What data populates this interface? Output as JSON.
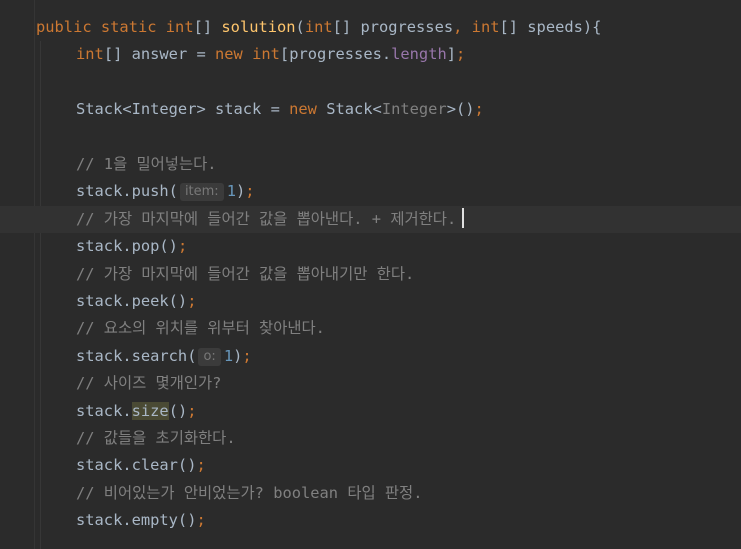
{
  "editor": {
    "lines": [
      {
        "tokens": [
          {
            "t": "public",
            "c": "kw"
          },
          {
            "t": " "
          },
          {
            "t": "static",
            "c": "kw"
          },
          {
            "t": " "
          },
          {
            "t": "int",
            "c": "kw"
          },
          {
            "t": "[] "
          },
          {
            "t": "solution",
            "c": "fn"
          },
          {
            "t": "("
          },
          {
            "t": "int",
            "c": "kw"
          },
          {
            "t": "[] progresses"
          },
          {
            "t": ",",
            "c": "kw"
          },
          {
            "t": " "
          },
          {
            "t": "int",
            "c": "kw"
          },
          {
            "t": "[] speeds){"
          }
        ]
      },
      {
        "tokens": [
          {
            "t": "int",
            "c": "kw"
          },
          {
            "t": "[] answer = "
          },
          {
            "t": "new",
            "c": "kw"
          },
          {
            "t": " "
          },
          {
            "t": "int",
            "c": "kw"
          },
          {
            "t": "[progresses."
          },
          {
            "t": "length",
            "c": "field"
          },
          {
            "t": "]"
          },
          {
            "t": ";",
            "c": "kw"
          }
        ]
      },
      {
        "tokens": []
      },
      {
        "tokens": [
          {
            "t": "Stack<Integer> stack = "
          },
          {
            "t": "new",
            "c": "kw"
          },
          {
            "t": " Stack<"
          },
          {
            "t": "Integer",
            "c": "generic"
          },
          {
            "t": ">()"
          },
          {
            "t": ";",
            "c": "kw"
          }
        ]
      },
      {
        "tokens": []
      },
      {
        "tokens": [
          {
            "t": "// 1을 밀어넣는다.",
            "c": "cmt"
          }
        ]
      },
      {
        "tokens": [
          {
            "t": "stack.push("
          },
          {
            "t": "item:",
            "c": "hint"
          },
          {
            "t": "1",
            "c": "num"
          },
          {
            "t": ")"
          },
          {
            "t": ";",
            "c": "kw"
          }
        ]
      },
      {
        "current": true,
        "tokens": [
          {
            "t": "// 가장 마지막에 들어간 값을 뽑아낸다. + 제거한다.",
            "c": "cmt"
          },
          {
            "t": "",
            "c": "caret"
          }
        ]
      },
      {
        "tokens": [
          {
            "t": "stack.pop()"
          },
          {
            "t": ";",
            "c": "kw"
          }
        ]
      },
      {
        "tokens": [
          {
            "t": "// 가장 마지막에 들어간 값을 뽑아내기만 한다.",
            "c": "cmt"
          }
        ]
      },
      {
        "tokens": [
          {
            "t": "stack.peek()"
          },
          {
            "t": ";",
            "c": "kw"
          }
        ]
      },
      {
        "tokens": [
          {
            "t": "// 요소의 위치를 위부터 찾아낸다.",
            "c": "cmt"
          }
        ]
      },
      {
        "tokens": [
          {
            "t": "stack.search("
          },
          {
            "t": "o:",
            "c": "hint"
          },
          {
            "t": "1",
            "c": "num"
          },
          {
            "t": ")"
          },
          {
            "t": ";",
            "c": "kw"
          }
        ]
      },
      {
        "tokens": [
          {
            "t": "// 사이즈 몇개인가?",
            "c": "cmt"
          }
        ]
      },
      {
        "tokens": [
          {
            "t": "stack."
          },
          {
            "t": "size",
            "c": "hl-size"
          },
          {
            "t": "()"
          },
          {
            "t": ";",
            "c": "kw"
          }
        ]
      },
      {
        "tokens": [
          {
            "t": "// 값들을 초기화한다.",
            "c": "cmt"
          }
        ]
      },
      {
        "tokens": [
          {
            "t": "stack.clear()"
          },
          {
            "t": ";",
            "c": "kw"
          }
        ]
      },
      {
        "tokens": [
          {
            "t": "// 비어있는가 안비었는가? boolean 타입 판정.",
            "c": "cmt"
          }
        ]
      },
      {
        "tokens": [
          {
            "t": "stack.empty()"
          },
          {
            "t": ";",
            "c": "kw"
          }
        ]
      }
    ]
  },
  "icons": {
    "intention_bulb": "lightbulb-icon"
  },
  "colors": {
    "background": "#2b2b2b",
    "keyword": "#cc7832",
    "function": "#ffc66d",
    "field": "#9876aa",
    "number": "#6897bb",
    "comment": "#808080",
    "text": "#a9b7c6",
    "bulb": "#f0c030"
  }
}
